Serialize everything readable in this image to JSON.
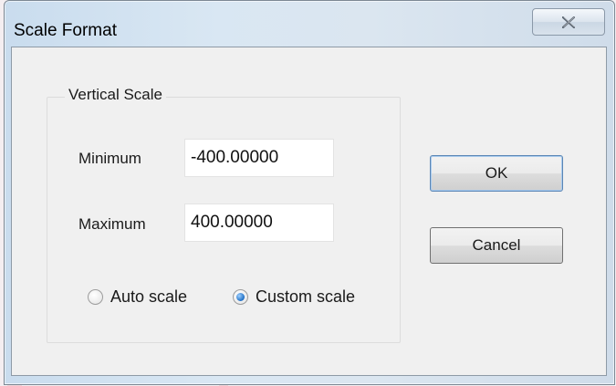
{
  "window": {
    "title": "Scale Format",
    "close_icon": "close-icon"
  },
  "group": {
    "label": "Vertical Scale"
  },
  "fields": {
    "minimum_label": "Minimum",
    "minimum_value": "-400.00000",
    "maximum_label": "Maximum",
    "maximum_value": "400.00000"
  },
  "scale_mode": {
    "options": [
      {
        "label": "Auto scale",
        "selected": false
      },
      {
        "label": "Custom scale",
        "selected": true
      }
    ]
  },
  "buttons": {
    "ok_label": "OK",
    "cancel_label": "Cancel"
  },
  "colors": {
    "accent": "#1f6fc4",
    "title_bar": "#d9e7f3"
  }
}
